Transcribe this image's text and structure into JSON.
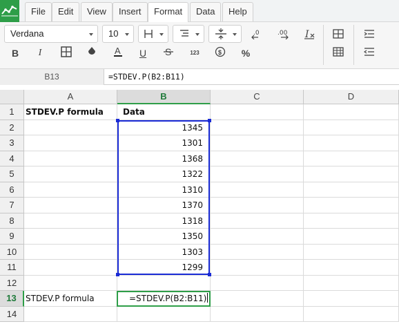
{
  "menu": [
    "File",
    "Edit",
    "View",
    "Insert",
    "Format",
    "Data",
    "Help"
  ],
  "active_menu": "Format",
  "toolbar": {
    "font_name": "Verdana",
    "font_size": "10",
    "number_format_label": "123",
    "percent_label": "%"
  },
  "formula_bar": {
    "cell_ref": "B13",
    "formula": "=STDEV.P(B2:B11)"
  },
  "columns": [
    "A",
    "B",
    "C",
    "D"
  ],
  "selected_column": "B",
  "rows": [
    "1",
    "2",
    "3",
    "4",
    "5",
    "6",
    "7",
    "8",
    "9",
    "10",
    "11",
    "12",
    "13",
    "14"
  ],
  "selected_row": "13",
  "cells": {
    "A1": "STDEV.P formula",
    "B1": "Data",
    "data_values": [
      "1345",
      "1301",
      "1368",
      "1322",
      "1310",
      "1370",
      "1318",
      "1350",
      "1303",
      "1299"
    ],
    "A13": "STDEV.P formula",
    "B13_edit": "=STDEV.P(B2:B11)"
  },
  "colors": {
    "accent": "#2e9e48",
    "selection": "#1a2bd6"
  }
}
